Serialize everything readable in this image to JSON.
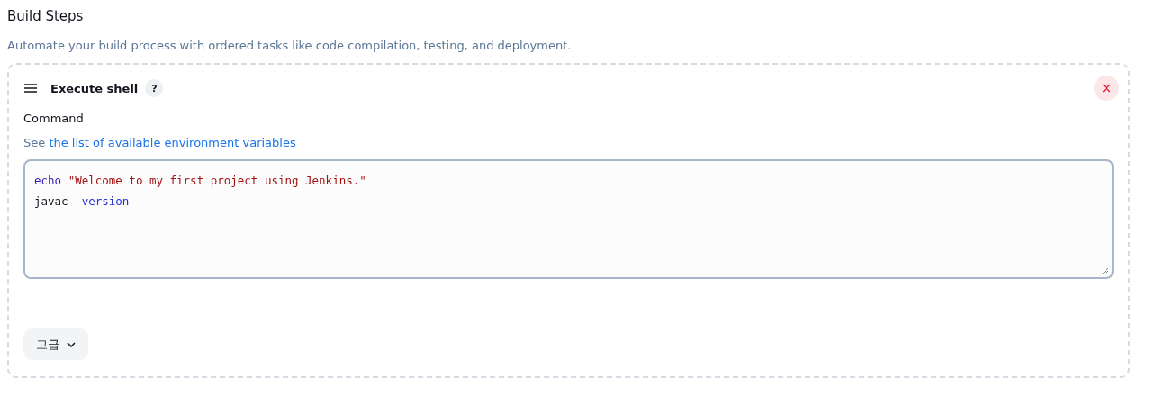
{
  "section": {
    "title": "Build Steps",
    "description": "Automate your build process with ordered tasks like code compilation, testing, and deployment."
  },
  "step": {
    "title": "Execute shell",
    "help": "?",
    "close": "×",
    "field_label": "Command",
    "hint_prefix": "See",
    "hint_link": "the list of available environment variables",
    "code_lines": [
      [
        {
          "kind": "keyword",
          "text": "echo"
        },
        {
          "kind": "string",
          "text": "\"Welcome to my first project using Jenkins.\""
        }
      ],
      [
        {
          "kind": "plain",
          "text": "javac"
        },
        {
          "kind": "option",
          "text": "-version"
        }
      ]
    ],
    "advanced_button": "고급"
  }
}
